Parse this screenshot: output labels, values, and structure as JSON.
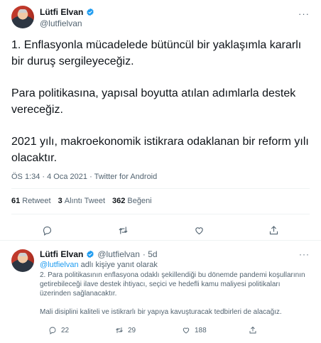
{
  "tweet": {
    "author_name": "Lütfi Elvan",
    "author_handle": "@lutfielvan",
    "more_icon": "···",
    "paragraphs": [
      "1. Enflasyonla mücadelede bütüncül bir yaklaşımla kararlı bir duruş sergileyeceğiz.",
      "Para politikasına, yapısal boyutta atılan adımlarla destek vereceğiz.",
      "2021 yılı, makroekonomik istikrara odaklanan bir reform yılı olacaktır."
    ],
    "timestamp": "ÖS 1:34 · 4 Oca 2021 · ",
    "source": "Twitter for Android",
    "stats": {
      "retweets": "61",
      "retweets_label": "Retweet",
      "quotes": "3",
      "quotes_label": "Alıntı Tweet",
      "likes": "362",
      "likes_label": "Beğeni"
    }
  },
  "reply": {
    "author_name": "Lütfi Elvan",
    "author_handle": "@lutfielvan",
    "age": "· 5d",
    "more_icon": "···",
    "reply_to_mention": "@lutfielvan",
    "reply_to_suffix": " adlı kişiye yanıt olarak",
    "paragraphs": [
      "2. Para politikasının enflasyona odaklı şekillendiği bu dönemde pandemi koşullarının getirebileceği ilave destek ihtiyacı, seçici ve hedefli kamu maliyesi politikaları üzerinden sağlanacaktır.",
      "Mali disiplini kaliteli ve istikrarlı bir yapıya kavuşturacak tedbirleri de alacağız."
    ],
    "counts": {
      "replies": "22",
      "retweets": "29",
      "likes": "188"
    }
  },
  "colors": {
    "verified": "#1d9bf0",
    "text": "#0f1419",
    "muted": "#536471",
    "divider": "#eff3f4"
  }
}
